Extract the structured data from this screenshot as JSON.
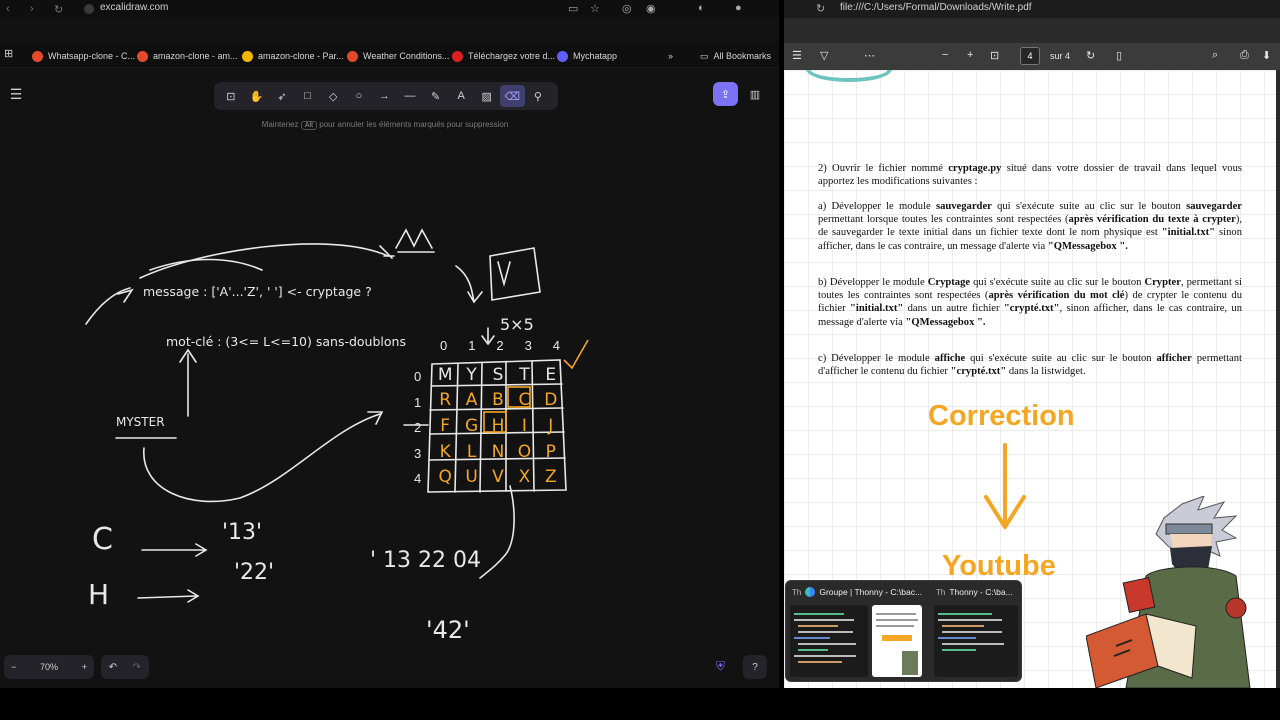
{
  "left_browser": {
    "url": "excalidraw.com",
    "bookmarks": [
      {
        "label": "Whatsapp-clone - C...",
        "color": "#e24a2b"
      },
      {
        "label": "amazon-clone - am...",
        "color": "#e24a2b"
      },
      {
        "label": "amazon-clone - Par...",
        "color": "#f5b800"
      },
      {
        "label": "Weather Conditions...",
        "color": "#e24a2b"
      },
      {
        "label": "Téléchargez votre d...",
        "color": "#e02020"
      },
      {
        "label": "Mychatapp",
        "color": "#5f5fff"
      }
    ],
    "all_bookmarks": "All Bookmarks",
    "hint_before": "Maintenez",
    "hint_key": "Alt",
    "hint_after": "pour annuler les éléments marqués pour suppression",
    "zoom": "70%",
    "tools": [
      "lock-icon",
      "hand-icon",
      "pointer-icon",
      "rectangle-icon",
      "diamond-icon",
      "ellipse-icon",
      "arrow-icon",
      "line-icon",
      "pencil-icon",
      "text-icon",
      "image-icon",
      "eraser-icon",
      "shapes-icon"
    ],
    "active_tool": "eraser-icon",
    "drawing": {
      "message_line": "message : ['A'...'Z', ' ']  <-  cryptage ?",
      "motcle_line": "mot-clé : (3<= L<=10) sans-doublons",
      "myster": "MYSTER",
      "grid_header": "5×5",
      "col_indices": [
        "0",
        "1",
        "2",
        "3",
        "4"
      ],
      "row_indices": [
        "0",
        "1",
        "2",
        "3",
        "4"
      ],
      "grid": [
        [
          "M",
          "Y",
          "S",
          "T",
          "E"
        ],
        [
          "R",
          "A",
          "B",
          "C",
          "D"
        ],
        [
          "F",
          "G",
          "H",
          "I",
          "J"
        ],
        [
          "K",
          "L",
          "N",
          "O",
          "P"
        ],
        [
          "Q",
          "U",
          "V",
          "X",
          "Z"
        ]
      ],
      "c_letter": "C",
      "c_code": "'13'",
      "h_letter": "H",
      "h_code": "'22'",
      "output": "' 13 22 04",
      "last_code": "'42'",
      "v_label": "V"
    }
  },
  "right_viewer": {
    "path": "file:///C:/Users/Formal/Downloads/Write.pdf",
    "page_current": "4",
    "page_total": "sur 4",
    "para2_a": "2) Ouvrir le fichier nommé ",
    "para2_file": "cryptage.py",
    "para2_b": " situé dans votre dossier de travail dans lequel vous apportez les modifications suivantes :",
    "pa_a": "a) Développer le module ",
    "pa_b1": "sauvegarder",
    "pa_c": " qui s'exécute suite au clic sur le bouton ",
    "pa_d": "sauvegarder",
    "pa_e": " permettant lorsque toutes les contraintes sont respectées (",
    "pa_f": "après vérification du texte à crypter",
    "pa_g": "), de sauvegarder le texte initial dans un fichier texte dont le nom physique est ",
    "pa_h": "\"initial.txt\"",
    "pa_i": " sinon afficher, dans le cas      contraire, un message d'alerte via ",
    "pa_j": "\"QMessagebox \".",
    "pb_a": "b) Développer le module ",
    "pb_b": "Cryptage",
    "pb_c": " qui s'exécute suite au clic sur le bouton ",
    "pb_d": "Crypter",
    "pb_e": ", permettant si toutes les contraintes sont respectées (",
    "pb_f": "après vérification du mot clé",
    "pb_g": ") de crypter le contenu du fichier ",
    "pb_h": "\"initial.txt\"",
    "pb_i": " dans un autre fichier ",
    "pb_j": "\"crypté.txt\"",
    "pb_k": ", sinon afficher, dans le cas contraire, un message d'alerte via ",
    "pb_l": "\"QMessagebox \".",
    "pc_a": "c) Développer le module ",
    "pc_b": "affiche",
    "pc_c": " qui s'exécute suite au clic sur le bouton ",
    "pc_d": "afficher",
    "pc_e": " permettant d'afficher le contenu du fichier ",
    "pc_f": "\"crypté.txt\"",
    "pc_g": " dans la listwidget.",
    "correction": "Correction",
    "youtube": "Youtube"
  },
  "taskbar_preview": {
    "items": [
      {
        "label": "Groupe | Thonny - C:\\bac..."
      },
      {
        "label": "Thonny - C:\\ba..."
      }
    ]
  },
  "colors": {
    "accent": "#7b72f3",
    "orange": "#f5a623",
    "chalk": "#e8e8e8"
  }
}
